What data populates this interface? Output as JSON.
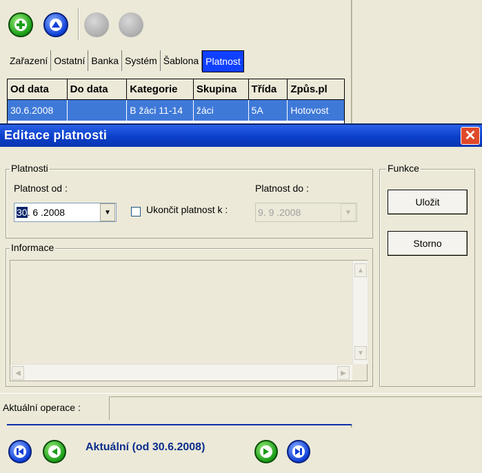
{
  "toolbar": {
    "add_icon": "plus-circle-icon",
    "up_icon": "arrow-up-circle-icon",
    "disabled1_icon": "disabled-circle-icon",
    "disabled2_icon": "disabled-circle-icon"
  },
  "tabs": [
    "Zařazení",
    "Ostatní",
    "Banka",
    "Systém",
    "Šablona",
    "Platnost"
  ],
  "grid": {
    "columns": [
      "Od data",
      "Do data",
      "Kategorie",
      "Skupina",
      "Třída",
      "Způs.pl"
    ],
    "rows": [
      [
        "30.6.2008",
        "",
        "B žáci 11-14",
        "žáci",
        "5A",
        "Hotovost"
      ]
    ]
  },
  "dialog": {
    "title": "Editace platnosti",
    "platnosti_group": "Platnosti",
    "platnost_od_label": "Platnost od :",
    "platnost_od_selected": "30",
    "platnost_od_rest": ". 6 .2008",
    "ukoncit_label": "Ukončit platnost k :",
    "platnost_do_label": "Platnost do :",
    "platnost_do_value": "9. 9 .2008",
    "informace_group": "Informace",
    "funkce_group": "Funkce",
    "ulozit_button": "Uložit",
    "storno_button": "Storno",
    "status_label": "Aktuální operace :"
  },
  "bottom": {
    "label": "Aktuální (od 30.6.2008)"
  },
  "colors": {
    "titlebar": "#0b3fc9",
    "selection": "#3f79d8",
    "active_tab": "#1040ff"
  }
}
